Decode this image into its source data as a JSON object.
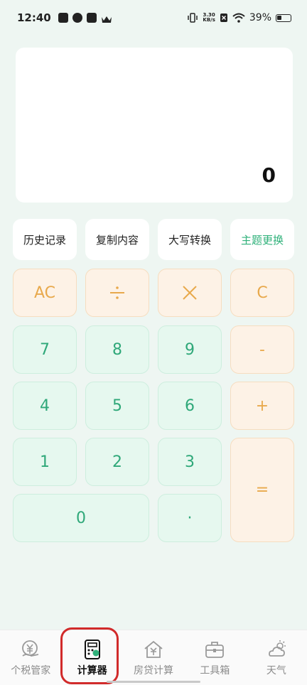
{
  "status_bar": {
    "time": "12:40",
    "net_speed_value": "3.30",
    "net_speed_unit": "KB/s",
    "battery": "39%",
    "icons": [
      "tiktok-icon",
      "app-icon",
      "mail-icon",
      "crown-icon",
      "vibrate-icon",
      "sim-off-icon",
      "wifi-icon",
      "battery-icon"
    ]
  },
  "display": {
    "value": "0"
  },
  "functions": [
    {
      "label": "历史记录"
    },
    {
      "label": "复制内容"
    },
    {
      "label": "大写转换"
    },
    {
      "label": "主题更换"
    }
  ],
  "keys": {
    "ac": "AC",
    "divide": "÷",
    "multiply": "×",
    "clear": "C",
    "seven": "7",
    "eight": "8",
    "nine": "9",
    "minus": "-",
    "four": "4",
    "five": "5",
    "six": "6",
    "plus": "+",
    "one": "1",
    "two": "2",
    "three": "3",
    "equals": "=",
    "zero": "0",
    "dot": "·"
  },
  "nav": [
    {
      "label": "个税管家",
      "icon": "tax-icon"
    },
    {
      "label": "计算器",
      "icon": "calculator-icon",
      "active": true
    },
    {
      "label": "房贷计算",
      "icon": "house-loan-icon"
    },
    {
      "label": "工具箱",
      "icon": "toolbox-icon"
    },
    {
      "label": "天气",
      "icon": "weather-icon"
    }
  ],
  "colors": {
    "accent_green": "#2fb17a",
    "operator_orange": "#e8a94c",
    "highlight_red": "#d12a2a"
  }
}
